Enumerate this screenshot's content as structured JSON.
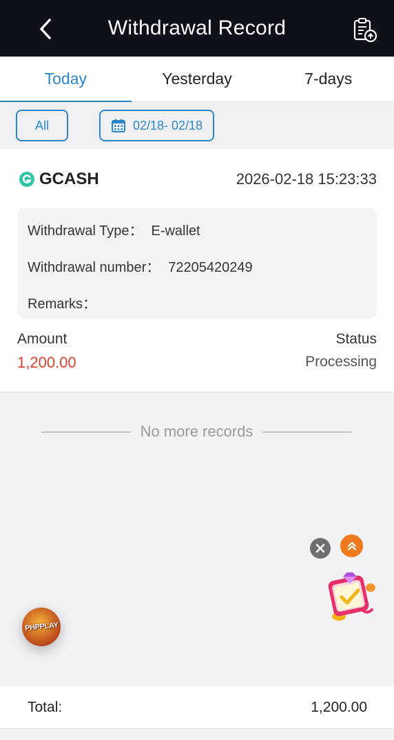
{
  "header": {
    "title": "Withdrawal Record",
    "back_icon": "chevron-left-icon",
    "record_icon": "clipboard-upload-icon"
  },
  "tabs": [
    {
      "label": "Today",
      "active": true
    },
    {
      "label": "Yesterday",
      "active": false
    },
    {
      "label": "7-days",
      "active": false
    }
  ],
  "filter": {
    "all_label": "All",
    "date_range": "02/18- 02/18",
    "date_icon": "calendar-icon"
  },
  "record": {
    "provider": "GCASH",
    "provider_icon": "gcash-logo-icon",
    "datetime": "2026-02-18 15:23:33",
    "type_label": "Withdrawal Type：",
    "type_value": "E-wallet",
    "number_label": "Withdrawal number：",
    "number_value": "72205420249",
    "remarks_label": "Remarks：",
    "remarks_value": "",
    "amount_label": "Amount",
    "amount_value": "1,200.00",
    "status_label": "Status",
    "status_value": "Processing"
  },
  "list_footer": {
    "no_more": "No more records"
  },
  "floating": {
    "close_icon": "close-icon",
    "scroll_top_icon": "double-chevron-up-icon",
    "promo_icon": "gift-envelope-icon",
    "logo_text": "PHPPLAY"
  },
  "total": {
    "label": "Total:",
    "value": "1,200.00"
  },
  "colors": {
    "accent": "#2a86c7",
    "header_bg": "#0f1119",
    "amount": "#d9402c",
    "gcash": "#2ec4a6"
  }
}
